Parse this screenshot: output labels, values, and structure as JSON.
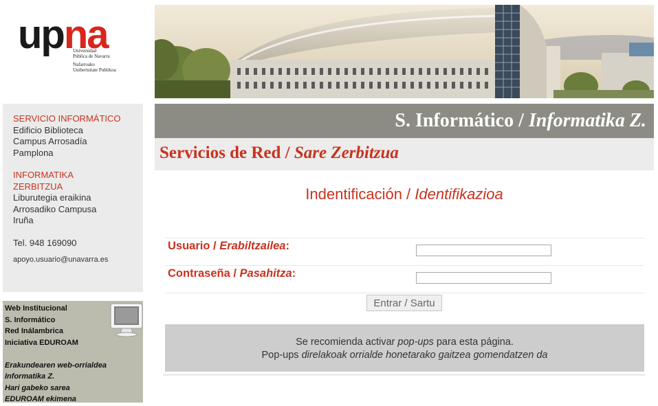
{
  "logo": {
    "up": "up",
    "na": "na",
    "lines_es": [
      "Universidad",
      "Pública de Navarra"
    ],
    "lines_eu": [
      "Nafarroako",
      "Unibertsitate Publikoa"
    ]
  },
  "banner": {
    "icon": "campus-building-photo"
  },
  "contact": {
    "es": {
      "title": "SERVICIO INFORMÁTICO",
      "line1": "Edificio Biblioteca",
      "line2": "Campus Arrosadía",
      "line3": "Pamplona"
    },
    "eu": {
      "title1": "INFORMATIKA",
      "title2": "ZERBITZUA",
      "line1": "Liburutegia eraikina",
      "line2": "Arrosadiko Campusa",
      "line3": "Iruña"
    },
    "phone": "Tel. 948 169090",
    "email": "apoyo.usuario@unavarra.es"
  },
  "links": {
    "icon": "monitor-icon",
    "es": [
      "Web Institucional",
      "S. Informático",
      "Red Inálambrica",
      "Iniciativa EDUROAM"
    ],
    "eu": [
      "Erakundearen web-orrialdea",
      "Informatika Z.",
      "Hari gabeko sarea",
      "EDUROAM ekimena"
    ]
  },
  "header": {
    "service_es": "S. Informático / ",
    "service_eu": "Informatika Z.",
    "net_es": "Servicios de Red / ",
    "net_eu": "Sare Zerbitzua"
  },
  "login": {
    "title_es": "Indentificación / ",
    "title_eu": "Identifikazioa",
    "user_label_es": "Usuario / ",
    "user_label_eu": "Erabiltzailea",
    "user_value": "",
    "pass_label_es": "Contraseña / ",
    "pass_label_eu": "Pasahitza",
    "pass_value": "",
    "colon": ":",
    "submit": "Entrar / Sartu"
  },
  "note": {
    "l1_a": "Se recomienda activar ",
    "l1_b": "pop-ups",
    "l1_c": " para esta página.",
    "l2_a": "Pop-ups ",
    "l2_b": "direlakoak orrialde honetarako gaitzea gomendatzen da"
  },
  "colors": {
    "accent_red": "#c8321e",
    "service_bar": "#8c8c84",
    "net_bar": "#ececec",
    "links_panel": "#bcbcae",
    "note_bg": "#cdcdcd"
  }
}
